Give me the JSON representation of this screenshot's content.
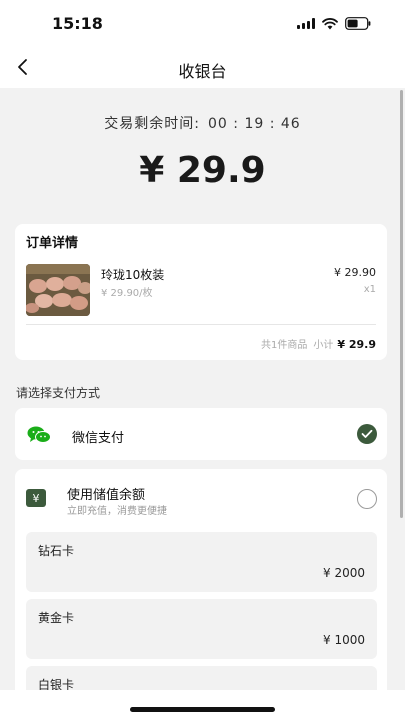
{
  "status_bar": {
    "time": "15:18"
  },
  "nav": {
    "title": "收银台"
  },
  "countdown": {
    "label": "交易剩余时间:",
    "value": "00 : 19 : 46"
  },
  "amount": "¥ 29.9",
  "order": {
    "title": "订单详情",
    "item": {
      "name": "玲珑10枚装",
      "unit_price": "¥ 29.90/枚",
      "price": "¥ 29.90",
      "qty": "x1"
    },
    "summary": {
      "count_text": "共1件商品",
      "subtotal_label": "小计",
      "subtotal_value": "¥ 29.9"
    }
  },
  "payment": {
    "section_label": "请选择支付方式",
    "wechat": {
      "label": "微信支付",
      "selected": true,
      "icon": "wechat-icon"
    },
    "balance": {
      "icon": "yen-icon",
      "title": "使用储值余额",
      "subtitle": "立即充值，消费更便捷",
      "selected": false,
      "cards": [
        {
          "name": "钻石卡",
          "value": "¥ 2000"
        },
        {
          "name": "黄金卡",
          "value": "¥ 1000"
        },
        {
          "name": "白银卡",
          "value": ""
        }
      ]
    }
  },
  "colors": {
    "accent_green": "#3c5a3c",
    "wechat_green": "#1aad19",
    "background": "#f2f2f2"
  }
}
